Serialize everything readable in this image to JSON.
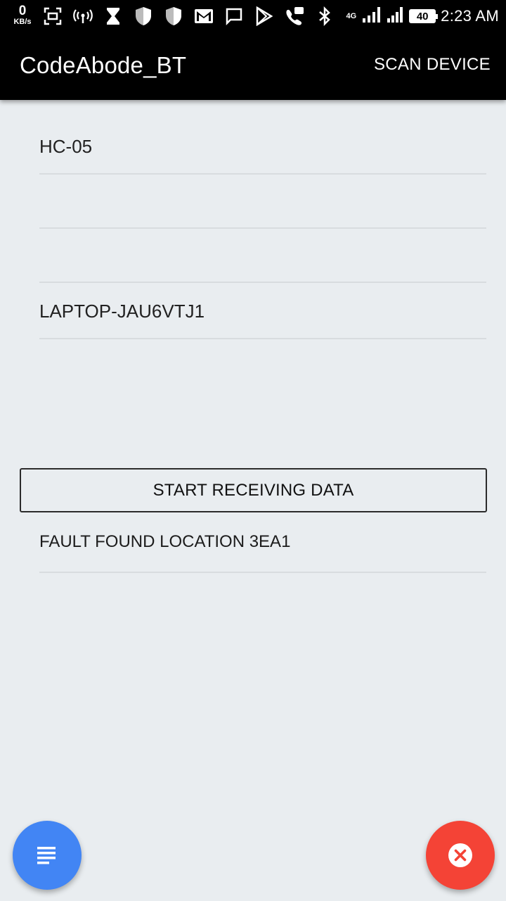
{
  "status_bar": {
    "net_speed_value": "0",
    "net_speed_unit": "KB/s",
    "network_type": "4G",
    "battery_level": "40",
    "time": "2:23 AM",
    "icons": [
      "screenshot-icon",
      "hotspot-icon",
      "hourglass-icon",
      "shield-icon",
      "shield-icon",
      "gmail-icon",
      "message-icon",
      "play-store-icon",
      "wifi-call-icon",
      "bluetooth-icon",
      "signal-icon",
      "signal-icon"
    ]
  },
  "app_bar": {
    "title": "CodeAbode_BT",
    "scan_label": "SCAN DEVICE"
  },
  "devices": [
    {
      "name": "HC-05"
    },
    {
      "name": ""
    },
    {
      "name": ""
    },
    {
      "name": "LAPTOP-JAU6VTJ1"
    }
  ],
  "start_button_label": "START RECEIVING DATA",
  "received": {
    "message": "FAULT FOUND LOCATION 3EA1"
  },
  "fab": {
    "left_icon": "list-icon",
    "left_color": "#4285f4",
    "right_icon": "close-icon",
    "right_color": "#f44336"
  }
}
